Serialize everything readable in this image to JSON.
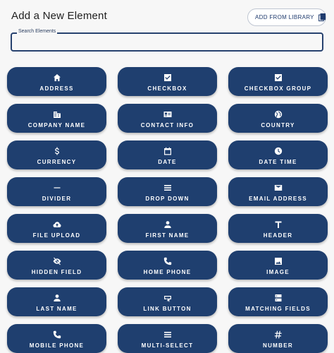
{
  "header": {
    "title": "Add a New Element",
    "library_button": "ADD FROM LIBRARY"
  },
  "search": {
    "label": "Search Elements",
    "value": ""
  },
  "elements": [
    {
      "label": "ADDRESS",
      "icon": "home-icon"
    },
    {
      "label": "CHECKBOX",
      "icon": "checkbox-icon"
    },
    {
      "label": "CHECKBOX GROUP",
      "icon": "checkbox-icon"
    },
    {
      "label": "COMPANY NAME",
      "icon": "building-icon"
    },
    {
      "label": "CONTACT INFO",
      "icon": "contact-card-icon"
    },
    {
      "label": "COUNTRY",
      "icon": "globe-icon"
    },
    {
      "label": "CURRENCY",
      "icon": "dollar-icon"
    },
    {
      "label": "DATE",
      "icon": "calendar-icon"
    },
    {
      "label": "DATE TIME",
      "icon": "clock-icon"
    },
    {
      "label": "DIVIDER",
      "icon": "minus-icon"
    },
    {
      "label": "DROP DOWN",
      "icon": "list-icon"
    },
    {
      "label": "EMAIL ADDRESS",
      "icon": "mail-icon"
    },
    {
      "label": "FILE UPLOAD",
      "icon": "cloud-upload-icon"
    },
    {
      "label": "FIRST NAME",
      "icon": "person-icon"
    },
    {
      "label": "HEADER",
      "icon": "text-t-icon"
    },
    {
      "label": "HIDDEN FIELD",
      "icon": "eye-off-icon"
    },
    {
      "label": "HOME PHONE",
      "icon": "phone-icon"
    },
    {
      "label": "IMAGE",
      "icon": "image-icon"
    },
    {
      "label": "LAST NAME",
      "icon": "person-icon"
    },
    {
      "label": "LINK BUTTON",
      "icon": "link-button-icon"
    },
    {
      "label": "MATCHING FIELDS",
      "icon": "matching-fields-icon"
    },
    {
      "label": "MOBILE PHONE",
      "icon": "phone-icon"
    },
    {
      "label": "MULTI-SELECT",
      "icon": "list-icon"
    },
    {
      "label": "NUMBER",
      "icon": "hash-icon"
    }
  ],
  "colors": {
    "tile": "#1f3f6f",
    "tile_text": "#ffffff",
    "accent": "#27426f"
  }
}
